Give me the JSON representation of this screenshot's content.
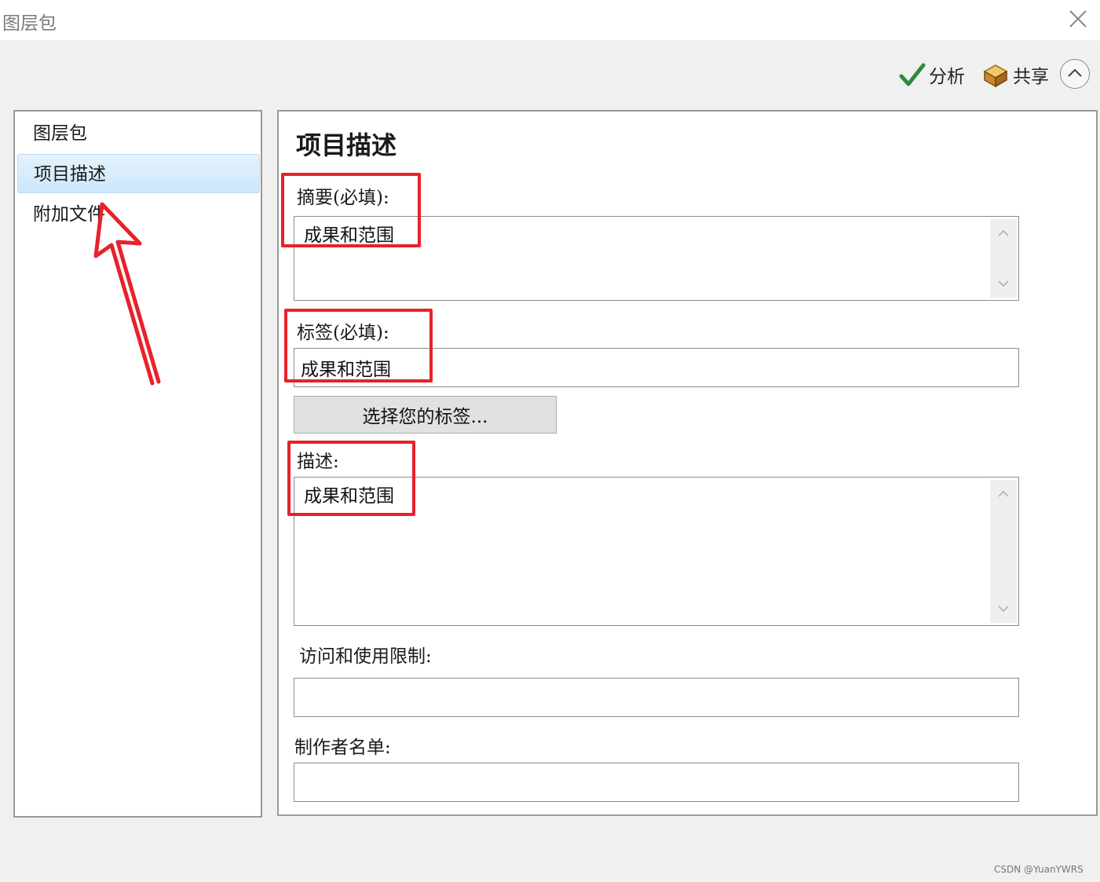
{
  "window": {
    "title": "图层包",
    "close_icon": "close-icon"
  },
  "toolbar": {
    "analyze_label": "分析",
    "share_label": "共享",
    "analyze_icon": "checkmark-icon",
    "share_icon": "package-icon",
    "collapse_icon": "chevron-up-icon"
  },
  "sidebar": {
    "items": [
      {
        "label": "图层包",
        "selected": false
      },
      {
        "label": "项目描述",
        "selected": true
      },
      {
        "label": "附加文件",
        "selected": false
      }
    ]
  },
  "main": {
    "section_title": "项目描述",
    "summary": {
      "label": "摘要(必填):",
      "value": "成果和范围"
    },
    "tags": {
      "label": "标签(必填):",
      "value": "成果和范围",
      "choose_button": "选择您的标签..."
    },
    "description": {
      "label": "描述:",
      "value": "成果和范围"
    },
    "access_limits": {
      "label": "访问和使用限制:",
      "value": ""
    },
    "credits": {
      "label": "制作者名单:",
      "value": ""
    }
  },
  "annotations": {
    "highlight_color": "#e8212a"
  },
  "colors": {
    "selection": "#cde7fb",
    "background": "#f0f0f0"
  },
  "watermark": "CSDN @YuanYWRS"
}
